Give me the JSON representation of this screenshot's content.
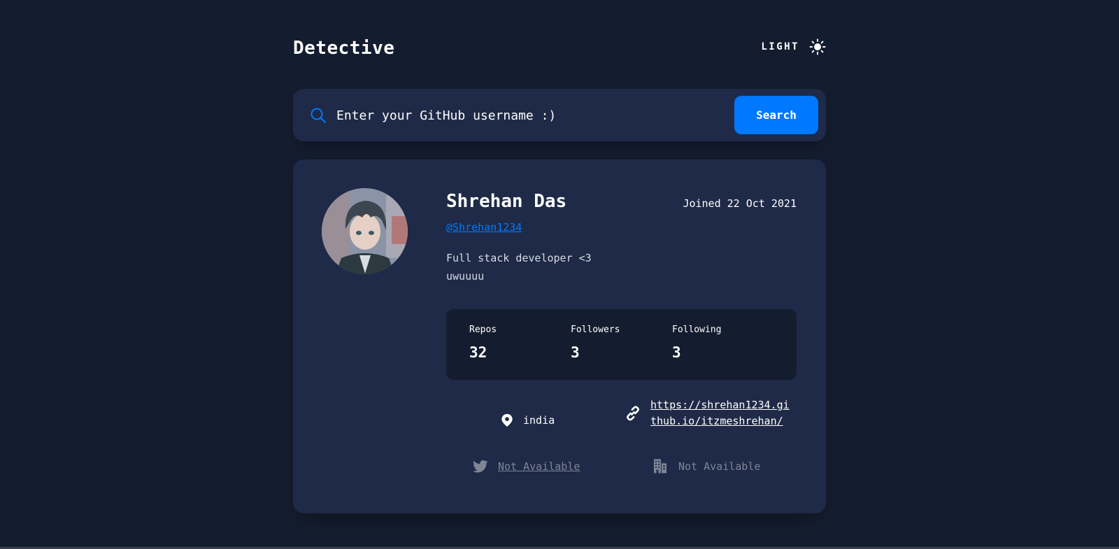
{
  "header": {
    "brand": "Detective",
    "theme_label": "LIGHT",
    "theme_icon": "sun-icon"
  },
  "search": {
    "icon": "search-icon",
    "placeholder": "Enter your GitHub username :)",
    "value": "",
    "button_label": "Search"
  },
  "profile": {
    "name": "Shrehan Das",
    "joined": "Joined 22 Oct 2021",
    "handle": "@Shrehan1234",
    "bio_line1": "Full stack developer <3",
    "bio_line2": "uwuuuu",
    "stats": {
      "repos_label": "Repos",
      "repos_value": "32",
      "followers_label": "Followers",
      "followers_value": "3",
      "following_label": "Following",
      "following_value": "3"
    },
    "location": "india",
    "blog": "https://shrehan1234.github.io/itzmeshrehan/",
    "twitter": "Not Available",
    "company": "Not Available"
  },
  "colors": {
    "background": "#141d2f",
    "card": "#1e2a47",
    "accent": "#0079ff",
    "muted": "#7d8597"
  }
}
